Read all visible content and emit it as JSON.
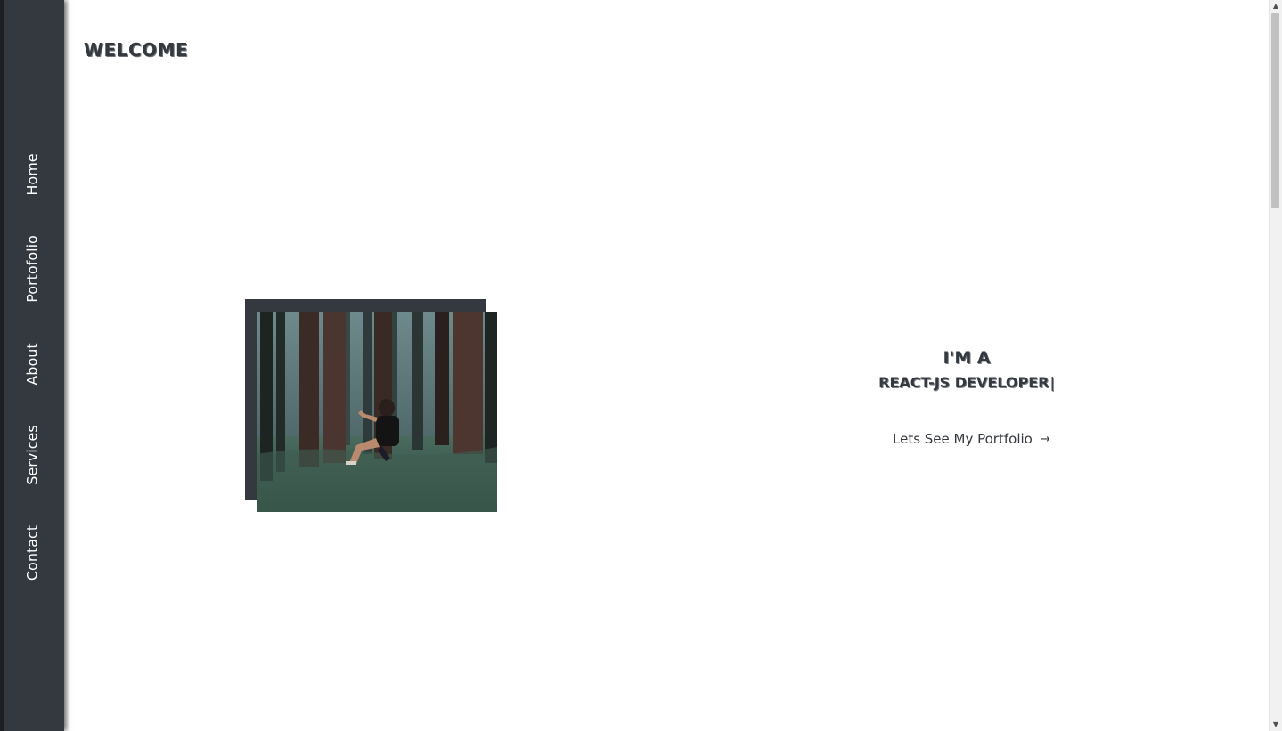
{
  "sidebar": {
    "items": [
      {
        "label": "Home"
      },
      {
        "label": "Portofolio"
      },
      {
        "label": "About"
      },
      {
        "label": "Services"
      },
      {
        "label": "Contact"
      }
    ]
  },
  "header": {
    "welcome": "WELCOME"
  },
  "hero": {
    "line1": "I'M A",
    "line2": "REACT-JS DEVELOPER",
    "cursor": "|",
    "cta_label": "Lets See My Portfolio",
    "cta_arrow": "→",
    "photo_alt": "forest-portrait-photo"
  },
  "scrollbar": {
    "up_arrow": "▲",
    "down_arrow": "▼"
  },
  "colors": {
    "sidebar": "#34383f",
    "accent_text": "#34383f",
    "background": "#ffffff"
  }
}
